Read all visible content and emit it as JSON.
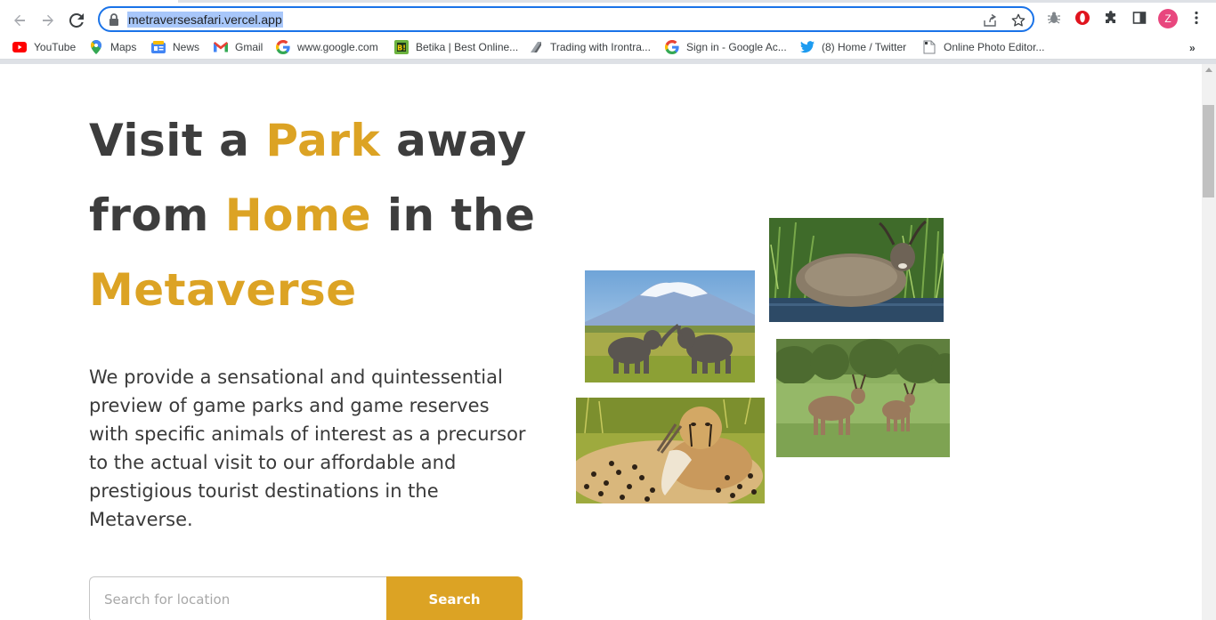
{
  "browser": {
    "url": "metraversesafari.vercel.app",
    "profile_initial": "Z",
    "icons": {
      "back": "arrow-left-icon",
      "forward": "arrow-right-icon",
      "reload": "reload-icon",
      "lock": "lock-icon",
      "share": "share-icon",
      "bookmark": "star-icon",
      "extensions": "puzzle-icon",
      "side_panel": "side-panel-icon",
      "menu": "kebab-menu-icon"
    },
    "bookmarks": [
      {
        "label": "YouTube",
        "icon": "youtube-icon"
      },
      {
        "label": "Maps",
        "icon": "maps-icon"
      },
      {
        "label": "News",
        "icon": "news-icon"
      },
      {
        "label": "Gmail",
        "icon": "gmail-icon"
      },
      {
        "label": "www.google.com",
        "icon": "google-icon"
      },
      {
        "label": "Betika | Best Online...",
        "icon": "betika-icon"
      },
      {
        "label": "Trading with Irontra...",
        "icon": "irontrade-icon"
      },
      {
        "label": "Sign in - Google Ac...",
        "icon": "google-icon"
      },
      {
        "label": "(8) Home / Twitter",
        "icon": "twitter-icon"
      },
      {
        "label": "Online Photo Editor...",
        "icon": "page-icon"
      }
    ],
    "more_bookmarks": "»"
  },
  "hero": {
    "title_parts": {
      "p1": "Visit a ",
      "p2": "Park",
      "p3": " away from ",
      "p4": "Home",
      "p5": " in the ",
      "p6": "Metaverse"
    },
    "description": "We provide a sensational and quintessential preview of game parks and game reserves with specific animals of interest as a precursor to the actual visit to our affordable and prestigious tourist destinations in the Metaverse.",
    "search_placeholder": "Search for location",
    "search_button": "Search"
  },
  "colors": {
    "accent": "#dca324",
    "text": "#3d3d3d",
    "focus_ring": "#1a73e8"
  },
  "gallery": [
    {
      "name": "elephants-photo"
    },
    {
      "name": "antelope-in-water-photo"
    },
    {
      "name": "eland-photo"
    },
    {
      "name": "cheetah-photo"
    }
  ]
}
